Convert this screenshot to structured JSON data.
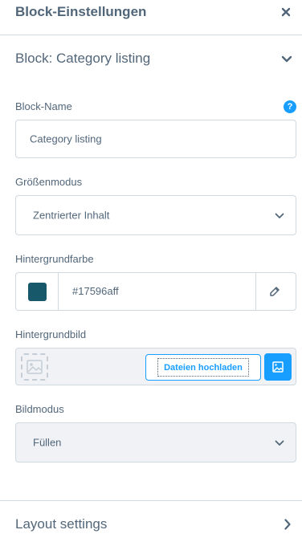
{
  "panel": {
    "title": "Block-Einstellungen",
    "close_icon": "close-icon"
  },
  "section": {
    "title": "Block: Category listing",
    "icon": "chevron-down-icon"
  },
  "fields": {
    "block_name": {
      "label": "Block-Name",
      "value": "Category listing",
      "help": "?"
    },
    "size_mode": {
      "label": "Größenmodus",
      "value": "Zentrierter Inhalt"
    },
    "bg_color": {
      "label": "Hintergrundfarbe",
      "value": "#17596aff",
      "swatch": "#17596a"
    },
    "bg_image": {
      "label": "Hintergrundbild",
      "upload_label": "Dateien hochladen",
      "media_icon": "image-icon"
    },
    "image_mode": {
      "label": "Bildmodus",
      "value": "Füllen"
    }
  },
  "footer": {
    "title": "Layout settings",
    "icon": "chevron-right-icon"
  },
  "colors": {
    "accent": "#189eff",
    "text": "#52667a",
    "border": "#d1d9e0",
    "disabled_bg": "#f0f2f5"
  }
}
